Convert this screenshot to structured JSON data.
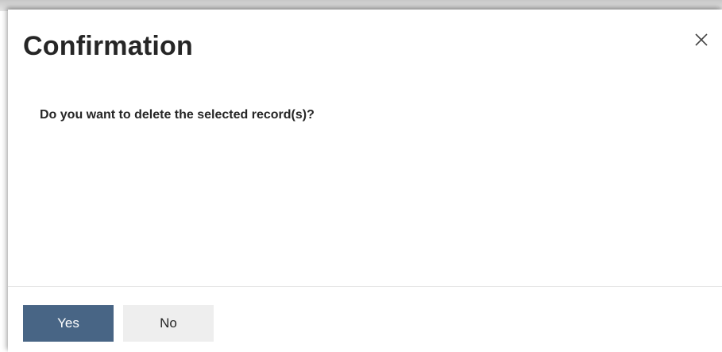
{
  "dialog": {
    "title": "Confirmation",
    "message": "Do you want to delete the selected record(s)?",
    "close_icon": "close-icon",
    "buttons": {
      "yes_label": "Yes",
      "no_label": "No"
    }
  },
  "colors": {
    "primary_button": "#486585",
    "secondary_button": "#eeeeee",
    "text": "#262626"
  }
}
